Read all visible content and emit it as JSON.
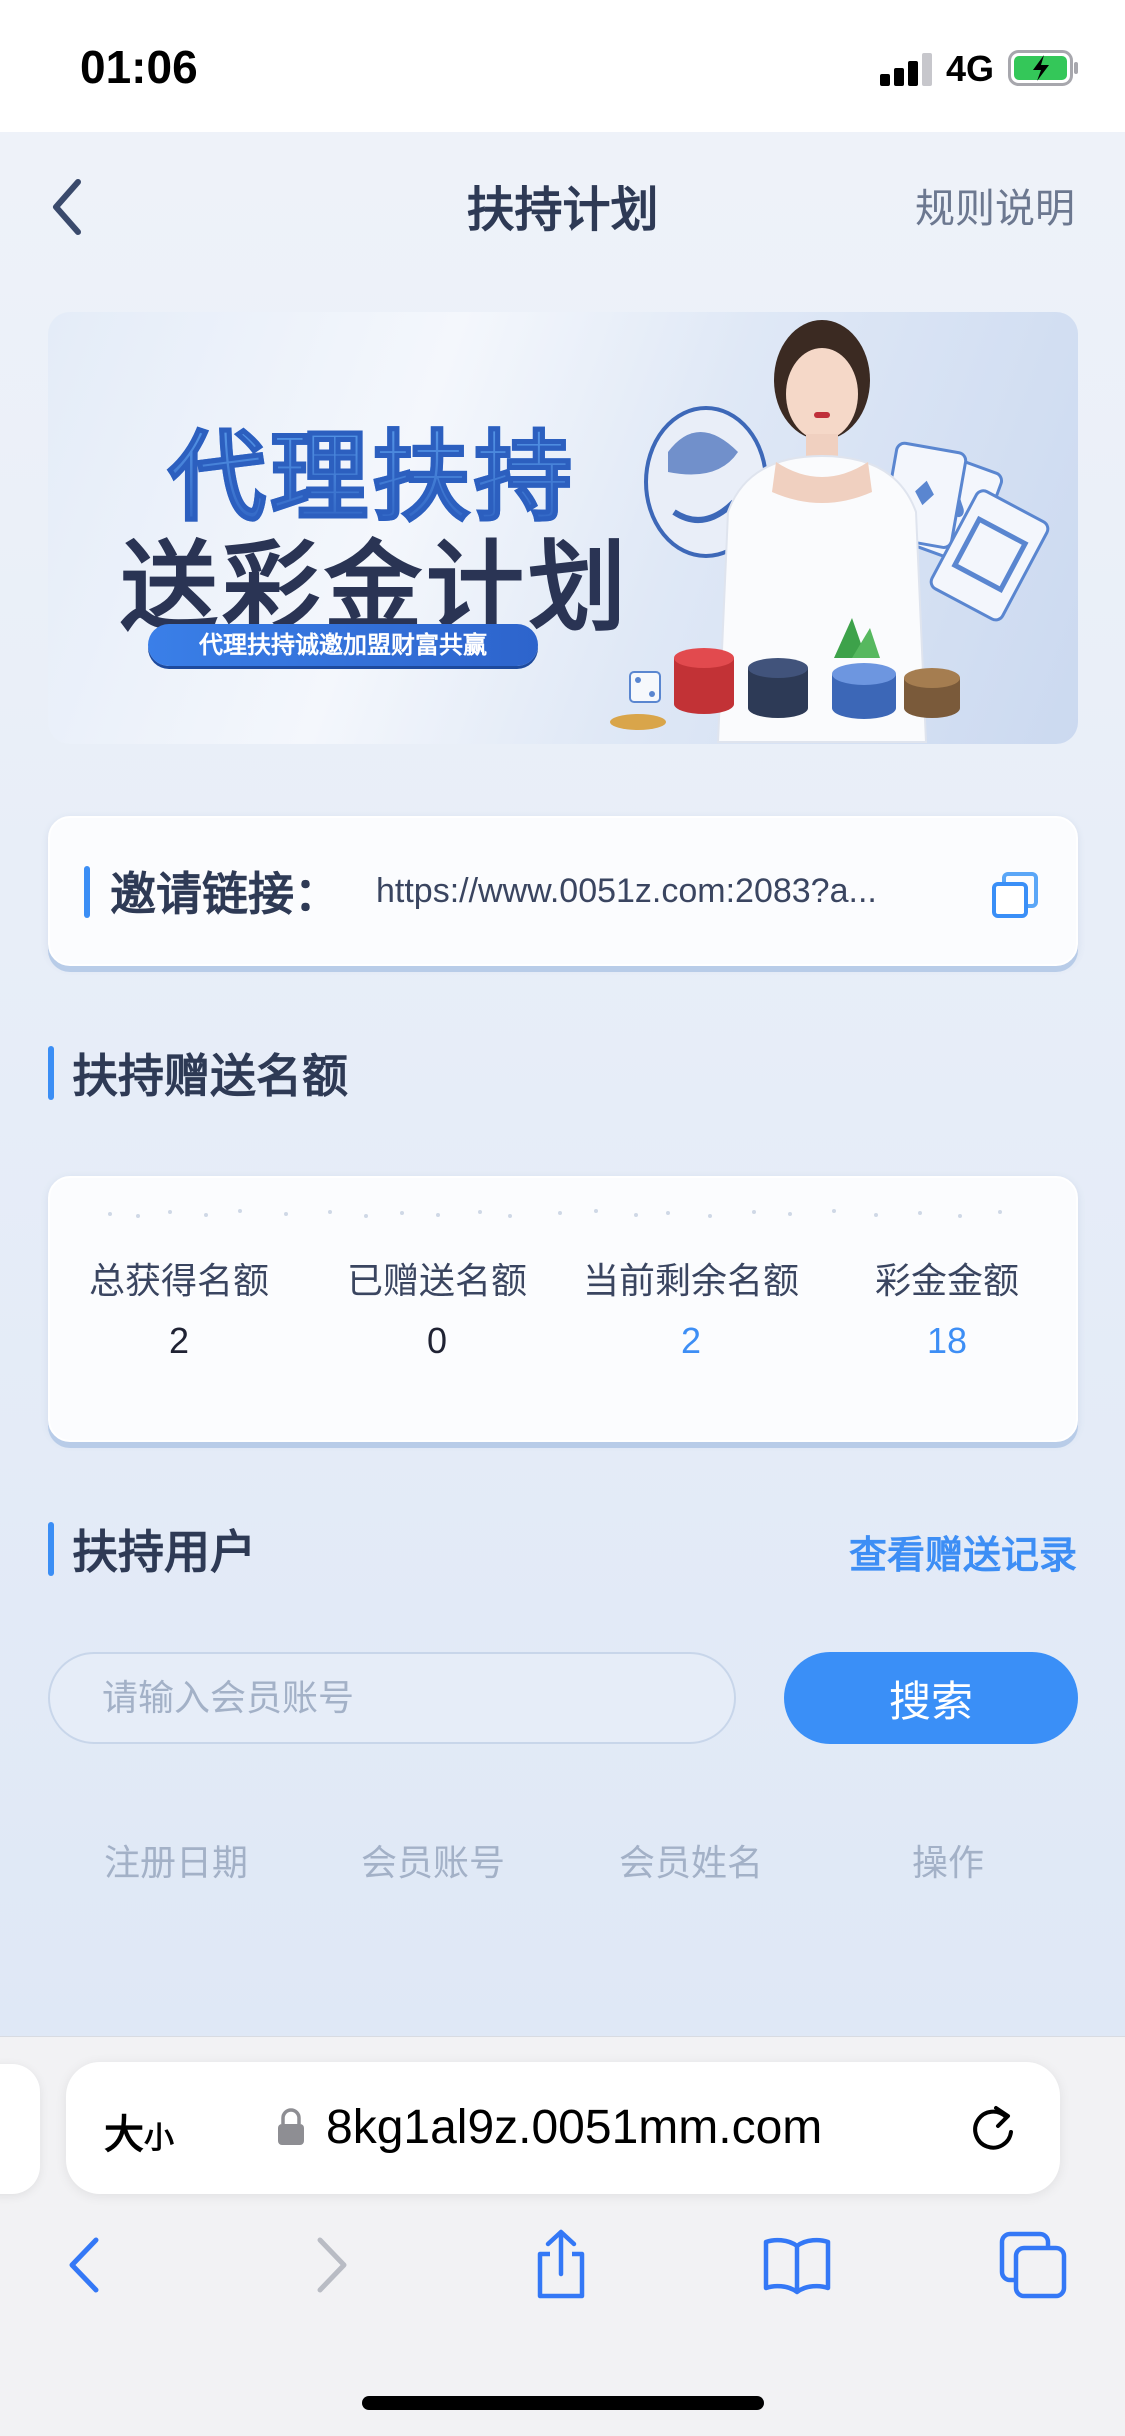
{
  "status_bar": {
    "time": "01:06",
    "network": "4G"
  },
  "nav": {
    "title": "扶持计划",
    "rules_label": "规则说明"
  },
  "banner": {
    "line1": "代理扶持",
    "line2": "送彩金计划",
    "pill": "代理扶持诚邀加盟财富共赢"
  },
  "invite": {
    "label": "邀请链接：",
    "url": "https://www.0051z.com:2083?a..."
  },
  "quota_section": {
    "title": "扶持赠送名额",
    "stats": [
      {
        "label": "总获得名额",
        "value": "2",
        "highlight": false
      },
      {
        "label": "已赠送名额",
        "value": "0",
        "highlight": false
      },
      {
        "label": "当前剩余名额",
        "value": "2",
        "highlight": true
      },
      {
        "label": "彩金金额",
        "value": "18",
        "highlight": true
      }
    ]
  },
  "users_section": {
    "title": "扶持用户",
    "record_link": "查看赠送记录",
    "search_placeholder": "请输入会员账号",
    "search_button": "搜索",
    "columns": [
      "注册日期",
      "会员账号",
      "会员姓名",
      "操作"
    ]
  },
  "browser": {
    "text_size_label": "大",
    "text_size_small": "小",
    "url": "8kg1al9z.0051mm.com"
  },
  "colors": {
    "accent": "#3a8ff7",
    "title": "#2e3a55",
    "muted": "#a3b1c7"
  }
}
